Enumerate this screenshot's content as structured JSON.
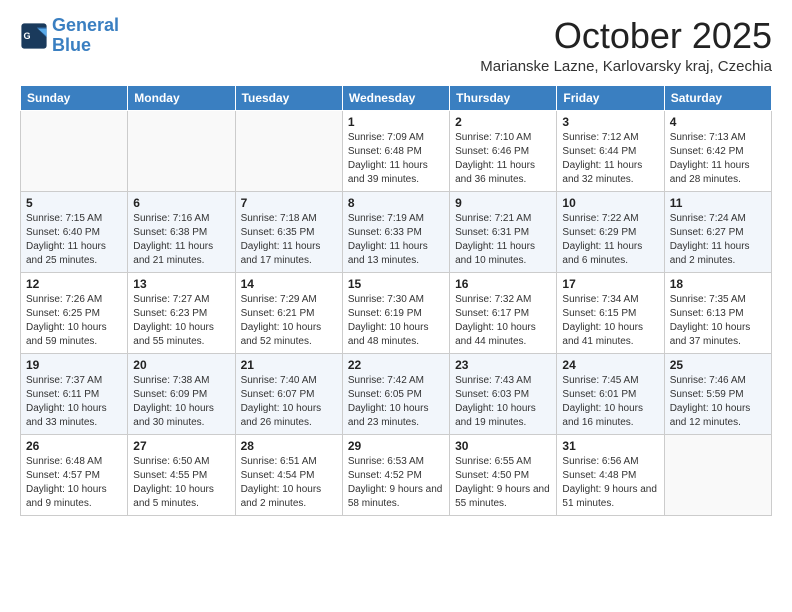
{
  "logo": {
    "line1": "General",
    "line2": "Blue"
  },
  "title": "October 2025",
  "location": "Marianske Lazne, Karlovarsky kraj, Czechia",
  "days_of_week": [
    "Sunday",
    "Monday",
    "Tuesday",
    "Wednesday",
    "Thursday",
    "Friday",
    "Saturday"
  ],
  "weeks": [
    [
      {
        "day": "",
        "info": ""
      },
      {
        "day": "",
        "info": ""
      },
      {
        "day": "",
        "info": ""
      },
      {
        "day": "1",
        "info": "Sunrise: 7:09 AM\nSunset: 6:48 PM\nDaylight: 11 hours and 39 minutes."
      },
      {
        "day": "2",
        "info": "Sunrise: 7:10 AM\nSunset: 6:46 PM\nDaylight: 11 hours and 36 minutes."
      },
      {
        "day": "3",
        "info": "Sunrise: 7:12 AM\nSunset: 6:44 PM\nDaylight: 11 hours and 32 minutes."
      },
      {
        "day": "4",
        "info": "Sunrise: 7:13 AM\nSunset: 6:42 PM\nDaylight: 11 hours and 28 minutes."
      }
    ],
    [
      {
        "day": "5",
        "info": "Sunrise: 7:15 AM\nSunset: 6:40 PM\nDaylight: 11 hours and 25 minutes."
      },
      {
        "day": "6",
        "info": "Sunrise: 7:16 AM\nSunset: 6:38 PM\nDaylight: 11 hours and 21 minutes."
      },
      {
        "day": "7",
        "info": "Sunrise: 7:18 AM\nSunset: 6:35 PM\nDaylight: 11 hours and 17 minutes."
      },
      {
        "day": "8",
        "info": "Sunrise: 7:19 AM\nSunset: 6:33 PM\nDaylight: 11 hours and 13 minutes."
      },
      {
        "day": "9",
        "info": "Sunrise: 7:21 AM\nSunset: 6:31 PM\nDaylight: 11 hours and 10 minutes."
      },
      {
        "day": "10",
        "info": "Sunrise: 7:22 AM\nSunset: 6:29 PM\nDaylight: 11 hours and 6 minutes."
      },
      {
        "day": "11",
        "info": "Sunrise: 7:24 AM\nSunset: 6:27 PM\nDaylight: 11 hours and 2 minutes."
      }
    ],
    [
      {
        "day": "12",
        "info": "Sunrise: 7:26 AM\nSunset: 6:25 PM\nDaylight: 10 hours and 59 minutes."
      },
      {
        "day": "13",
        "info": "Sunrise: 7:27 AM\nSunset: 6:23 PM\nDaylight: 10 hours and 55 minutes."
      },
      {
        "day": "14",
        "info": "Sunrise: 7:29 AM\nSunset: 6:21 PM\nDaylight: 10 hours and 52 minutes."
      },
      {
        "day": "15",
        "info": "Sunrise: 7:30 AM\nSunset: 6:19 PM\nDaylight: 10 hours and 48 minutes."
      },
      {
        "day": "16",
        "info": "Sunrise: 7:32 AM\nSunset: 6:17 PM\nDaylight: 10 hours and 44 minutes."
      },
      {
        "day": "17",
        "info": "Sunrise: 7:34 AM\nSunset: 6:15 PM\nDaylight: 10 hours and 41 minutes."
      },
      {
        "day": "18",
        "info": "Sunrise: 7:35 AM\nSunset: 6:13 PM\nDaylight: 10 hours and 37 minutes."
      }
    ],
    [
      {
        "day": "19",
        "info": "Sunrise: 7:37 AM\nSunset: 6:11 PM\nDaylight: 10 hours and 33 minutes."
      },
      {
        "day": "20",
        "info": "Sunrise: 7:38 AM\nSunset: 6:09 PM\nDaylight: 10 hours and 30 minutes."
      },
      {
        "day": "21",
        "info": "Sunrise: 7:40 AM\nSunset: 6:07 PM\nDaylight: 10 hours and 26 minutes."
      },
      {
        "day": "22",
        "info": "Sunrise: 7:42 AM\nSunset: 6:05 PM\nDaylight: 10 hours and 23 minutes."
      },
      {
        "day": "23",
        "info": "Sunrise: 7:43 AM\nSunset: 6:03 PM\nDaylight: 10 hours and 19 minutes."
      },
      {
        "day": "24",
        "info": "Sunrise: 7:45 AM\nSunset: 6:01 PM\nDaylight: 10 hours and 16 minutes."
      },
      {
        "day": "25",
        "info": "Sunrise: 7:46 AM\nSunset: 5:59 PM\nDaylight: 10 hours and 12 minutes."
      }
    ],
    [
      {
        "day": "26",
        "info": "Sunrise: 6:48 AM\nSunset: 4:57 PM\nDaylight: 10 hours and 9 minutes."
      },
      {
        "day": "27",
        "info": "Sunrise: 6:50 AM\nSunset: 4:55 PM\nDaylight: 10 hours and 5 minutes."
      },
      {
        "day": "28",
        "info": "Sunrise: 6:51 AM\nSunset: 4:54 PM\nDaylight: 10 hours and 2 minutes."
      },
      {
        "day": "29",
        "info": "Sunrise: 6:53 AM\nSunset: 4:52 PM\nDaylight: 9 hours and 58 minutes."
      },
      {
        "day": "30",
        "info": "Sunrise: 6:55 AM\nSunset: 4:50 PM\nDaylight: 9 hours and 55 minutes."
      },
      {
        "day": "31",
        "info": "Sunrise: 6:56 AM\nSunset: 4:48 PM\nDaylight: 9 hours and 51 minutes."
      },
      {
        "day": "",
        "info": ""
      }
    ]
  ]
}
